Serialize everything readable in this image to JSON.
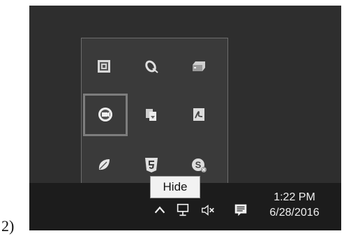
{
  "figure": {
    "label": "2)"
  },
  "tooltip": {
    "text": "Hide"
  },
  "tray_overflow": {
    "icons": [
      {
        "name": "realtek-audio-icon"
      },
      {
        "name": "satellite-dish-icon"
      },
      {
        "name": "removable-drive-icon"
      },
      {
        "name": "record-icon",
        "selected": true
      },
      {
        "name": "file-copy-icon"
      },
      {
        "name": "adobe-acrobat-icon"
      },
      {
        "name": "leaf-app-icon"
      },
      {
        "name": "html5-shield-icon"
      },
      {
        "name": "skype-icon"
      }
    ]
  },
  "taskbar": {
    "icons": [
      "chevron-up-icon",
      "network-icon",
      "volume-muted-icon",
      "action-center-icon"
    ],
    "clock": {
      "time": "1:22 PM",
      "date": "6/28/2016"
    }
  },
  "colors": {
    "desktop": "#2e2e2e",
    "flyout": "#3a3a3a",
    "taskbar": "#1c1c1c",
    "tooltip_bg": "#f2f2f2"
  }
}
